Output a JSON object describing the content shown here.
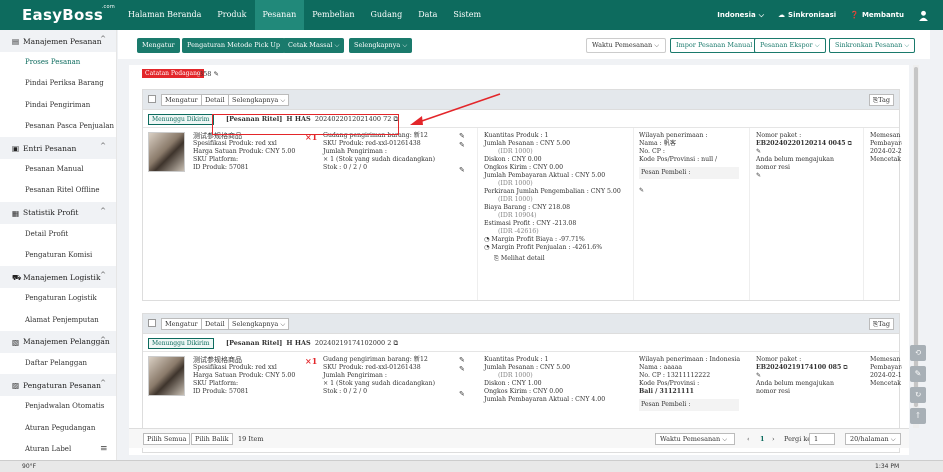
{
  "app": {
    "logo": "EasyBoss",
    "logo_sup": ".com"
  },
  "nav": [
    "Halaman Beranda",
    "Produk",
    "Pesanan",
    "Pembelian",
    "Gudang",
    "Data",
    "Sistem"
  ],
  "topright": {
    "lang": "Indonesia",
    "sync": "Sinkronisasi",
    "help": "Membantu"
  },
  "sidebar": {
    "groups": [
      {
        "label": "Manajemen Pesanan",
        "items": [
          "Proses Pesanan",
          "Pindai Periksa Barang",
          "Pindai Pengiriman",
          "Pesanan Pasca Penjualan"
        ]
      },
      {
        "label": "Entri Pesanan",
        "items": [
          "Pesanan Manual",
          "Pesanan Ritel Offline"
        ]
      },
      {
        "label": "Statistik Profit",
        "items": [
          "Detail Profit",
          "Pengaturan Komisi"
        ]
      },
      {
        "label": "Manajemen Logistik",
        "items": [
          "Pengaturan Logistik",
          "Alamat Penjemputan"
        ]
      },
      {
        "label": "Manajemen Pelanggan",
        "items": [
          "Daftar Pelanggan"
        ]
      },
      {
        "label": "Pengaturan Pesanan",
        "items": [
          "Penjadwalan Otomatis",
          "Aturan Pegudangan",
          "Aturan Label"
        ]
      }
    ]
  },
  "toolbar": {
    "left": [
      "Mengatur",
      "Pengaturan Metode Pick Up",
      "Cetak Massal",
      "Selengkapnya"
    ],
    "right": [
      "Waktu Pemesanan",
      "Impor Pesanan Manual",
      "Pesanan Ekspor",
      "Sinkronkan Pesanan"
    ]
  },
  "notes": {
    "tag": "Catatan Pedagang",
    "count": "358"
  },
  "order_bar": {
    "buttons": [
      "Mengatur",
      "Detail",
      "Selengkapnya"
    ],
    "tag": "Tag"
  },
  "orders": [
    {
      "status": "Menunggu Dikirim",
      "type": "[Pesanan Ritel]",
      "store": "H HAS",
      "id": "2024022012021400 72",
      "product": {
        "name": "测试参规格商品",
        "spec": "Spesifikasi Produk:  red xxl",
        "price": "Harga Satuan Produk:  CNY 5.00",
        "sku_platform": "SKU Platform:",
        "product_id": "ID Produk:  57081"
      },
      "qty": "×1",
      "warehouse": {
        "gudang": "Gudang pengiriman barang:  新12",
        "sku": "SKU Produk:  red-xxl-01261438",
        "jumlah": "Jumlah Pengiriman :",
        "detail": "×  1  (Stok yang sudah dicadangkan)",
        "stok": "Stok          :  0 / 2 / 0"
      },
      "finance": [
        "Kuantitas Produk :  1",
        "Jumlah Pesanan :  CNY 5.00",
        "(IDR 1000)",
        "Diskon :  CNY 0.00",
        "Ongkos Kirim :  CNY 0.00",
        "Jumlah Pembayaran Aktual :  CNY 5.00",
        "(IDR 1000)",
        "Perkiraan Jumlah Pengembalian :  CNY 5.00",
        "(IDR 1000)",
        "Biaya Barang :  CNY 218.08",
        "(IDR 10904)",
        "Estimasi Profit :  CNY -213.08",
        "(IDR -42616)",
        "Margin Profit Biaya :  -97.71%",
        "Margin Profit Penjualan :  -4261.6%"
      ],
      "detail_link": "Melihat detail",
      "buyer": {
        "wilayah": "Wilayah penerimaan :",
        "nama": "Nama :  帆客",
        "cp": "No. CP :",
        "kode": "Kode Pos/Provinsi :  null /",
        "pesan": "Pesan Pembeli :"
      },
      "paket": {
        "nomor": "Nomor paket :",
        "eb": "EB20240220120214 0045",
        "resi": "Anda belum mengajukan nomor resi"
      },
      "time": {
        "memesan": "Memesan :  2024-",
        "pembayaran": "Pembayaran :",
        "date": "2024-02-20 12:02",
        "mencetak": "Mencetak :  2024-"
      }
    },
    {
      "status": "Menunggu Dikirim",
      "type": "[Pesanan Ritel]",
      "store": "H HAS",
      "id": "20240219174102000 2",
      "product": {
        "name": "测试参规格商品",
        "spec": "Spesifikasi Produk:  red xxl",
        "price": "Harga Satuan Produk:  CNY 5.00",
        "sku_platform": "SKU Platform:",
        "product_id": "ID Produk:  57081"
      },
      "qty": "×1",
      "warehouse": {
        "gudang": "Gudang pengiriman barang:  新12",
        "sku": "SKU Produk:  red-xxl-01261438",
        "jumlah": "Jumlah Pengiriman :",
        "detail": "×  1  (Stok yang sudah dicadangkan)",
        "stok": "Stok          :  0 / 2 / 0"
      },
      "finance": [
        "Kuantitas Produk :  1",
        "Jumlah Pesanan :  CNY 5.00",
        "(IDR 1000)",
        "Diskon :  CNY 1.00",
        "Ongkos Kirim :  CNY 0.00",
        "Jumlah Pembayaran Aktual :  CNY 4.00"
      ],
      "buyer": {
        "wilayah": "Wilayah penerimaan :  Indonesia",
        "nama": "Nama :  aaaaa",
        "cp": "No. CP :  13211112222",
        "kode": "Kode Pos/Provinsi :",
        "kode2": "Bali / 31121111",
        "pesan": "Pesan Pembeli :"
      },
      "paket": {
        "nomor": "Nomor paket :",
        "eb": "EB20240219174100 085",
        "resi": "Anda belum mengajukan nomor resi"
      },
      "time": {
        "memesan": "Memesan :  2024-",
        "pembayaran": "Pembayaran :",
        "date": "2024-02-19 17:41",
        "mencetak": "Mencetak :  2024-"
      }
    }
  ],
  "footer": {
    "select_all": "Pilih Semua",
    "invert": "Pilih Balik",
    "count": "19 Item",
    "sort": "Waktu Pemesanan",
    "page": "1",
    "goto": "Pergi ke",
    "goto_val": "1",
    "per_page": "20/halaman"
  },
  "taskbar": {
    "left": "90°F",
    "time": "1:34 PM"
  },
  "colors": {
    "primary": "#0d6b5e",
    "accent": "#1a7a6c",
    "danger": "#e3262a"
  }
}
